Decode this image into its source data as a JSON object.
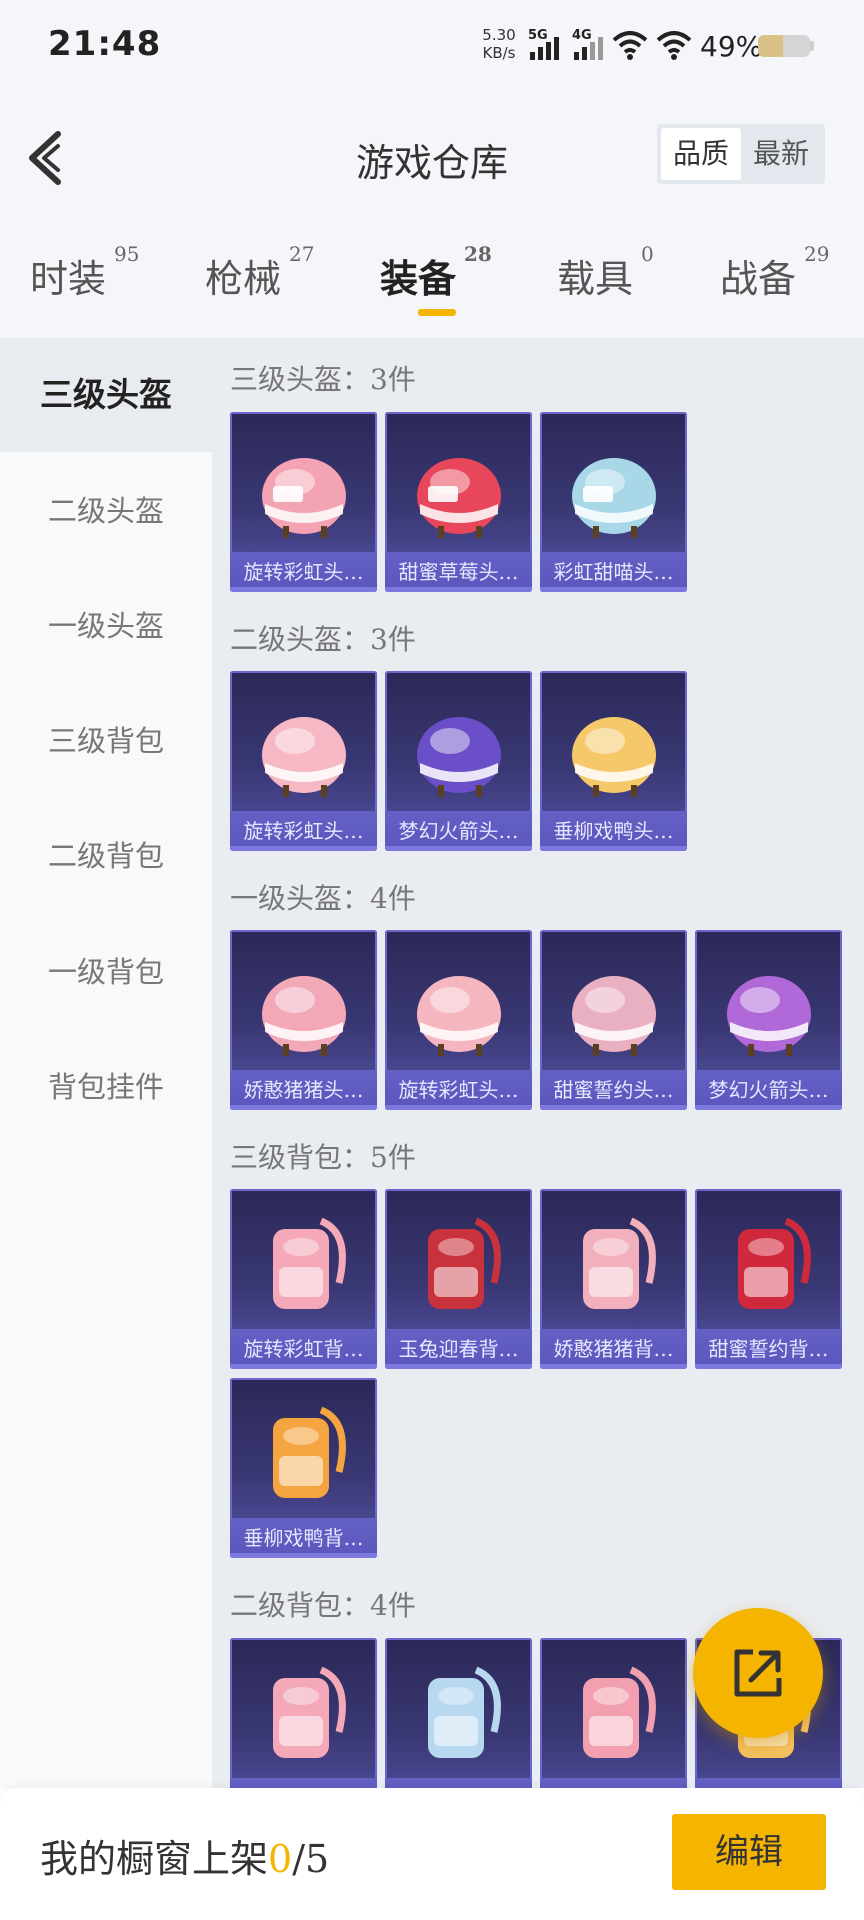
{
  "status_bar": {
    "time": "21:48",
    "net_speed_value": "5.30",
    "net_speed_unit": "KB/s",
    "signal1": "5G",
    "signal2": "4G",
    "battery_pct": "49%",
    "battery_level": 0.49
  },
  "header": {
    "title": "游戏仓库",
    "sort_options": [
      "品质",
      "最新"
    ],
    "sort_selected": "品质"
  },
  "tabs": [
    {
      "label": "时装",
      "count": "95"
    },
    {
      "label": "枪械",
      "count": "27"
    },
    {
      "label": "装备",
      "count": "28"
    },
    {
      "label": "载具",
      "count": "0"
    },
    {
      "label": "战备",
      "count": "29"
    }
  ],
  "active_tab": "装备",
  "sidebar": {
    "items": [
      "三级头盔",
      "二级头盔",
      "一级头盔",
      "三级背包",
      "二级背包",
      "一级背包",
      "背包挂件"
    ],
    "active": "三级头盔"
  },
  "sections": [
    {
      "title": "三级头盔：3件",
      "items": [
        {
          "name": "旋转彩虹头…",
          "icon": "helmet-lv3-icon",
          "color": "#f4a3b5"
        },
        {
          "name": "甜蜜草莓头…",
          "icon": "helmet-lv3-icon",
          "color": "#e8465a"
        },
        {
          "name": "彩虹甜喵头…",
          "icon": "helmet-lv3-icon",
          "color": "#a8d8e8"
        }
      ]
    },
    {
      "title": "二级头盔：3件",
      "items": [
        {
          "name": "旋转彩虹头…",
          "icon": "helmet-lv2-icon",
          "color": "#f6b8c4"
        },
        {
          "name": "梦幻火箭头…",
          "icon": "helmet-lv2-icon",
          "color": "#6a4fc8"
        },
        {
          "name": "垂柳戏鸭头…",
          "icon": "helmet-lv2-icon",
          "color": "#f5c96a"
        }
      ]
    },
    {
      "title": "一级头盔：4件",
      "items": [
        {
          "name": "娇憨猪猪头…",
          "icon": "helmet-lv1-icon",
          "color": "#f3a8b8"
        },
        {
          "name": "旋转彩虹头…",
          "icon": "helmet-lv1-icon",
          "color": "#f6b6c0"
        },
        {
          "name": "甜蜜誓约头…",
          "icon": "helmet-lv1-icon",
          "color": "#e8b0c0"
        },
        {
          "name": "梦幻火箭头…",
          "icon": "helmet-lv1-icon",
          "color": "#b168d8"
        }
      ]
    },
    {
      "title": "三级背包：5件",
      "items": [
        {
          "name": "旋转彩虹背…",
          "icon": "backpack-lv3-icon",
          "color": "#f4a8b8"
        },
        {
          "name": "玉兔迎春背…",
          "icon": "backpack-lv3-icon",
          "color": "#c8323c"
        },
        {
          "name": "娇憨猪猪背…",
          "icon": "backpack-lv3-icon",
          "color": "#f2b0bc"
        },
        {
          "name": "甜蜜誓约背…",
          "icon": "backpack-lv3-icon",
          "color": "#d0283c"
        },
        {
          "name": "垂柳戏鸭背…",
          "icon": "backpack-lv3-icon",
          "color": "#f5a540"
        }
      ]
    },
    {
      "title": "二级背包：4件",
      "items": [
        {
          "name": "",
          "icon": "backpack-lv2-icon",
          "color": "#f4a8b8"
        },
        {
          "name": "",
          "icon": "backpack-lv2-icon",
          "color": "#b8d8f0"
        },
        {
          "name": "",
          "icon": "backpack-lv2-icon",
          "color": "#f2a0b0"
        },
        {
          "name": "",
          "icon": "backpack-lv2-icon",
          "color": "#f5c060"
        }
      ]
    }
  ],
  "bottom_bar": {
    "shop_label": "我的橱窗上架",
    "shop_current": "0",
    "shop_total": "/5",
    "edit_label": "编辑"
  },
  "colors": {
    "accent": "#f5b400",
    "card_bg": "#3a3874"
  }
}
